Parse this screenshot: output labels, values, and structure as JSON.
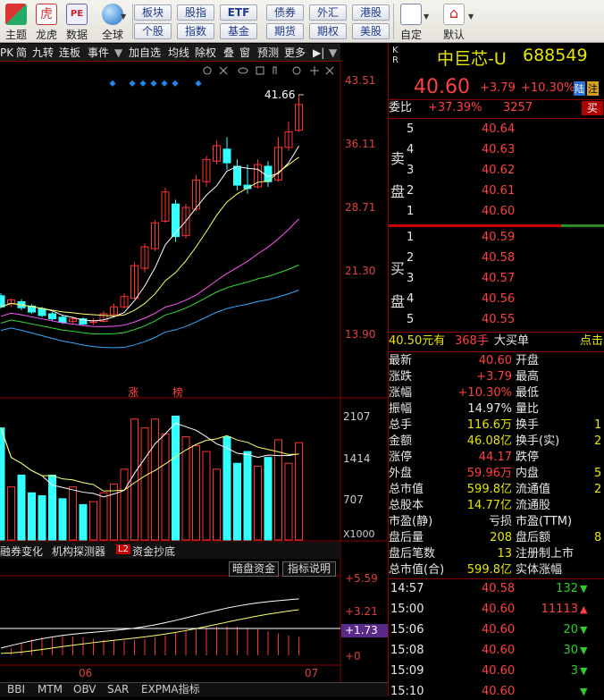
{
  "toolbar": {
    "big_buttons": [
      {
        "label": "主题",
        "icon": "theme-icon"
      },
      {
        "label": "龙虎",
        "icon": "dragon-tiger-icon"
      },
      {
        "label": "数据",
        "icon": "data-icon"
      },
      {
        "label": "全球",
        "icon": "globe-icon"
      }
    ],
    "row1": [
      "板块",
      "股指",
      "ETF",
      "债券",
      "外汇",
      "港股"
    ],
    "row2": [
      "个股",
      "指数",
      "基金",
      "期货",
      "期权",
      "美股"
    ],
    "custom_label": "自定",
    "default_label": "默认"
  },
  "chart_tabs": [
    "PK",
    "简",
    "九转",
    "连板",
    "事件",
    "加自选",
    "均线",
    "除权",
    "叠",
    "窗",
    "预测",
    "更多"
  ],
  "price_axis": [
    "43.51",
    "36.11",
    "28.71",
    "21.30",
    "13.90"
  ],
  "high_marker": "41.66",
  "limit_markers": [
    "涨",
    "榜"
  ],
  "volume_axis": [
    "2107",
    "1414",
    "707",
    "X1000"
  ],
  "indicator_tabs": [
    "融券变化",
    "机构探测器",
    "资金抄底"
  ],
  "indicator_badge": "L2",
  "macd_buttons": [
    "暗盘资金",
    "指标说明"
  ],
  "macd_axis": [
    "+5.59",
    "+3.21",
    "+1.73",
    "+0"
  ],
  "date_labels": [
    "06",
    "07"
  ],
  "bottom_tabs": [
    "BBI",
    "MTM",
    "OBV",
    "SAR",
    "EXPMA指标"
  ],
  "stock": {
    "kr": "K R",
    "name": "中巨芯-U",
    "code": "688549",
    "price": "40.60",
    "change": "+3.79",
    "change_pct": "+10.30%",
    "tag1": "陆",
    "tag2": "注"
  },
  "weibi": {
    "label": "委比",
    "pct": "+37.39%",
    "value": "3257",
    "btn": "买"
  },
  "sell": {
    "side_label": [
      "卖",
      "盘"
    ],
    "rows": [
      {
        "level": "5",
        "price": "40.64"
      },
      {
        "level": "4",
        "price": "40.63"
      },
      {
        "level": "3",
        "price": "40.62"
      },
      {
        "level": "2",
        "price": "40.61"
      },
      {
        "level": "1",
        "price": "40.60"
      }
    ]
  },
  "buy": {
    "side_label": [
      "买",
      "盘"
    ],
    "rows": [
      {
        "level": "1",
        "price": "40.59"
      },
      {
        "level": "2",
        "price": "40.58"
      },
      {
        "level": "3",
        "price": "40.57"
      },
      {
        "level": "4",
        "price": "40.56"
      },
      {
        "level": "5",
        "price": "40.55"
      }
    ]
  },
  "big_buy": {
    "price": "40.50元有",
    "qty": "368手",
    "label": "大买单",
    "extra": "点击"
  },
  "stats": [
    {
      "l1": "最新",
      "v1": "40.60",
      "c1": "red",
      "l2": "开盘",
      "v2": ""
    },
    {
      "l1": "涨跌",
      "v1": "+3.79",
      "c1": "red",
      "l2": "最高",
      "v2": ""
    },
    {
      "l1": "涨幅",
      "v1": "+10.30%",
      "c1": "red",
      "l2": "最低",
      "v2": ""
    },
    {
      "l1": "振幅",
      "v1": "14.97%",
      "c1": "white",
      "l2": "量比",
      "v2": ""
    },
    {
      "l1": "总手",
      "v1": "116.6万",
      "c1": "yellow",
      "l2": "换手",
      "v2": "1"
    },
    {
      "l1": "金额",
      "v1": "46.08亿",
      "c1": "yellow",
      "l2": "换手(实)",
      "v2": "2"
    },
    {
      "l1": "涨停",
      "v1": "44.17",
      "c1": "red",
      "l2": "跌停",
      "v2": ""
    },
    {
      "l1": "外盘",
      "v1": "59.96万",
      "c1": "red",
      "l2": "内盘",
      "v2": "5"
    },
    {
      "l1": "总市值",
      "v1": "599.8亿",
      "c1": "yellow",
      "l2": "流通值",
      "v2": "2"
    },
    {
      "l1": "总股本",
      "v1": "14.77亿",
      "c1": "yellow",
      "l2": "流通股",
      "v2": ""
    },
    {
      "l1": "市盈(静)",
      "v1": "亏损",
      "c1": "white",
      "l2": "市盈(TTM)",
      "v2": ""
    },
    {
      "l1": "盘后量",
      "v1": "208",
      "c1": "yellow",
      "l2": "盘后额",
      "v2": "8"
    },
    {
      "l1": "盘后笔数",
      "v1": "13",
      "c1": "yellow",
      "l2": "注册制上市",
      "v2": ""
    },
    {
      "l1": "总市值(合)",
      "v1": "599.8亿",
      "c1": "yellow",
      "l2": "实体涨幅",
      "v2": ""
    }
  ],
  "ticks": [
    {
      "time": "14:57",
      "price": "40.58",
      "vol": "132",
      "dir": "down"
    },
    {
      "time": "15:00",
      "price": "40.60",
      "vol": "11113",
      "dir": "up"
    },
    {
      "time": "15:06",
      "price": "40.60",
      "vol": "20",
      "dir": "down"
    },
    {
      "time": "15:08",
      "price": "40.60",
      "vol": "30",
      "dir": "down"
    },
    {
      "time": "15:09",
      "price": "40.60",
      "vol": "3",
      "dir": "down"
    },
    {
      "time": "15:10",
      "price": "40.60",
      "vol": "",
      "dir": "down"
    }
  ],
  "colors": {
    "up": "#ff3333",
    "down": "#33ffff",
    "ma5": "#ffffff",
    "ma10": "#ffff66",
    "ma20": "#ff55ff",
    "ma30": "#33dd33",
    "ma60": "#33aaff"
  }
}
